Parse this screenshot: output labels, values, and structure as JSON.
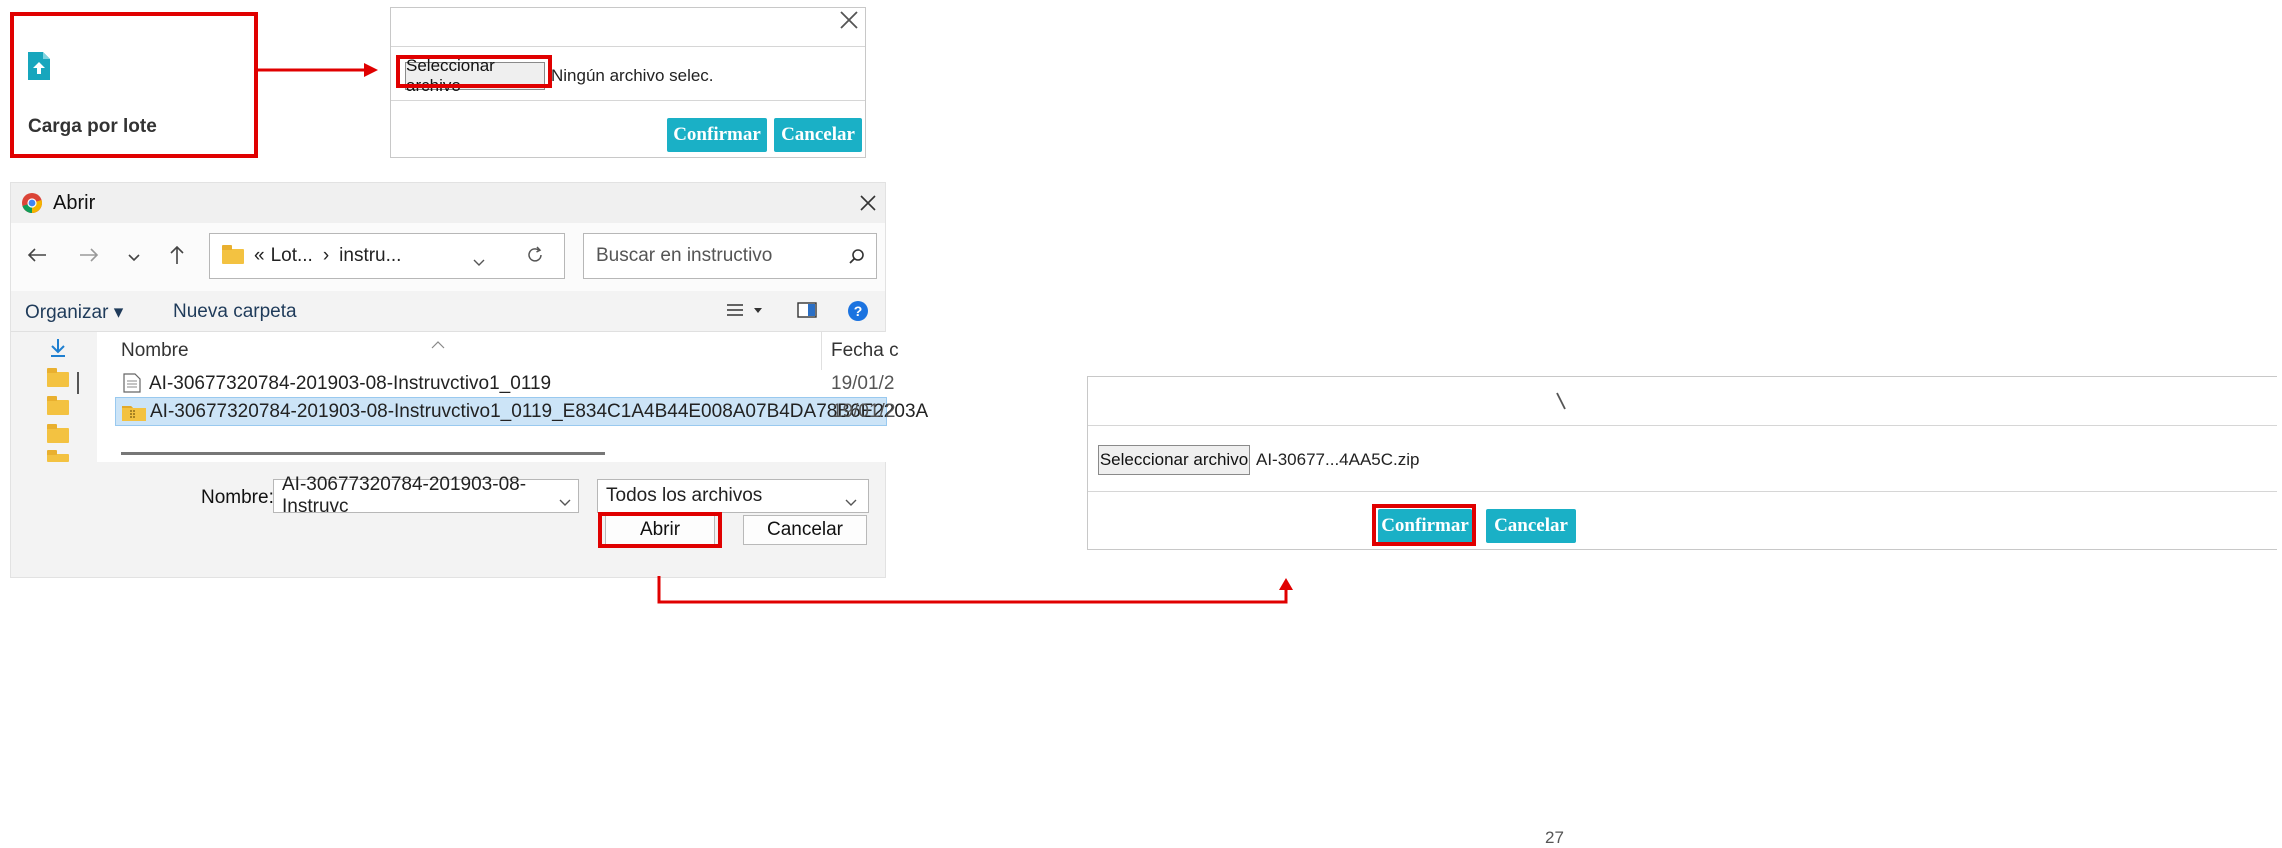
{
  "tile": {
    "label": "Carga por lote",
    "icon": "file-upload-icon"
  },
  "upload_modal_1": {
    "select_button": "Seleccionar archivo",
    "file_status": "Ningún archivo selec.",
    "confirm_label": "Confirmar",
    "cancel_label": "Cancelar",
    "close_icon": "close-icon"
  },
  "open_dialog": {
    "title": "Abrir",
    "app_icon": "chrome-icon",
    "breadcrumb": {
      "root": "«",
      "part1": "Lot...",
      "separator": "›",
      "part2": "instru..."
    },
    "search_placeholder": "Buscar en instructivo",
    "toolbar": {
      "organize": "Organizar ▾",
      "new_folder": "Nueva carpeta"
    },
    "columns": {
      "name": "Nombre",
      "date": "Fecha c"
    },
    "files": [
      {
        "name": "AI-30677320784-201903-08-Instruvctivo1_0119",
        "date": "19/01/2",
        "icon": "document-icon",
        "selected": false
      },
      {
        "name": "AI-30677320784-201903-08-Instruvctivo1_0119_E834C1A4B44E008A07B4DA78B6E2203A",
        "date": "19/01/2",
        "icon": "zip-folder-icon",
        "selected": true
      }
    ],
    "filename_label": "Nombre:",
    "filename_value": "AI-30677320784-201903-08-Instruvc",
    "filetype_value": "Todos los archivos",
    "open_button": "Abrir",
    "cancel_button": "Cancelar"
  },
  "upload_modal_2": {
    "select_button": "Seleccionar archivo",
    "file_status": "AI-30677...4AA5C.zip",
    "confirm_label": "Confirmar",
    "cancel_label": "Cancelar"
  },
  "page_number": "27",
  "colors": {
    "highlight": "#e00000",
    "accent": "#1ab0c6",
    "selection": "#cce4f7"
  }
}
